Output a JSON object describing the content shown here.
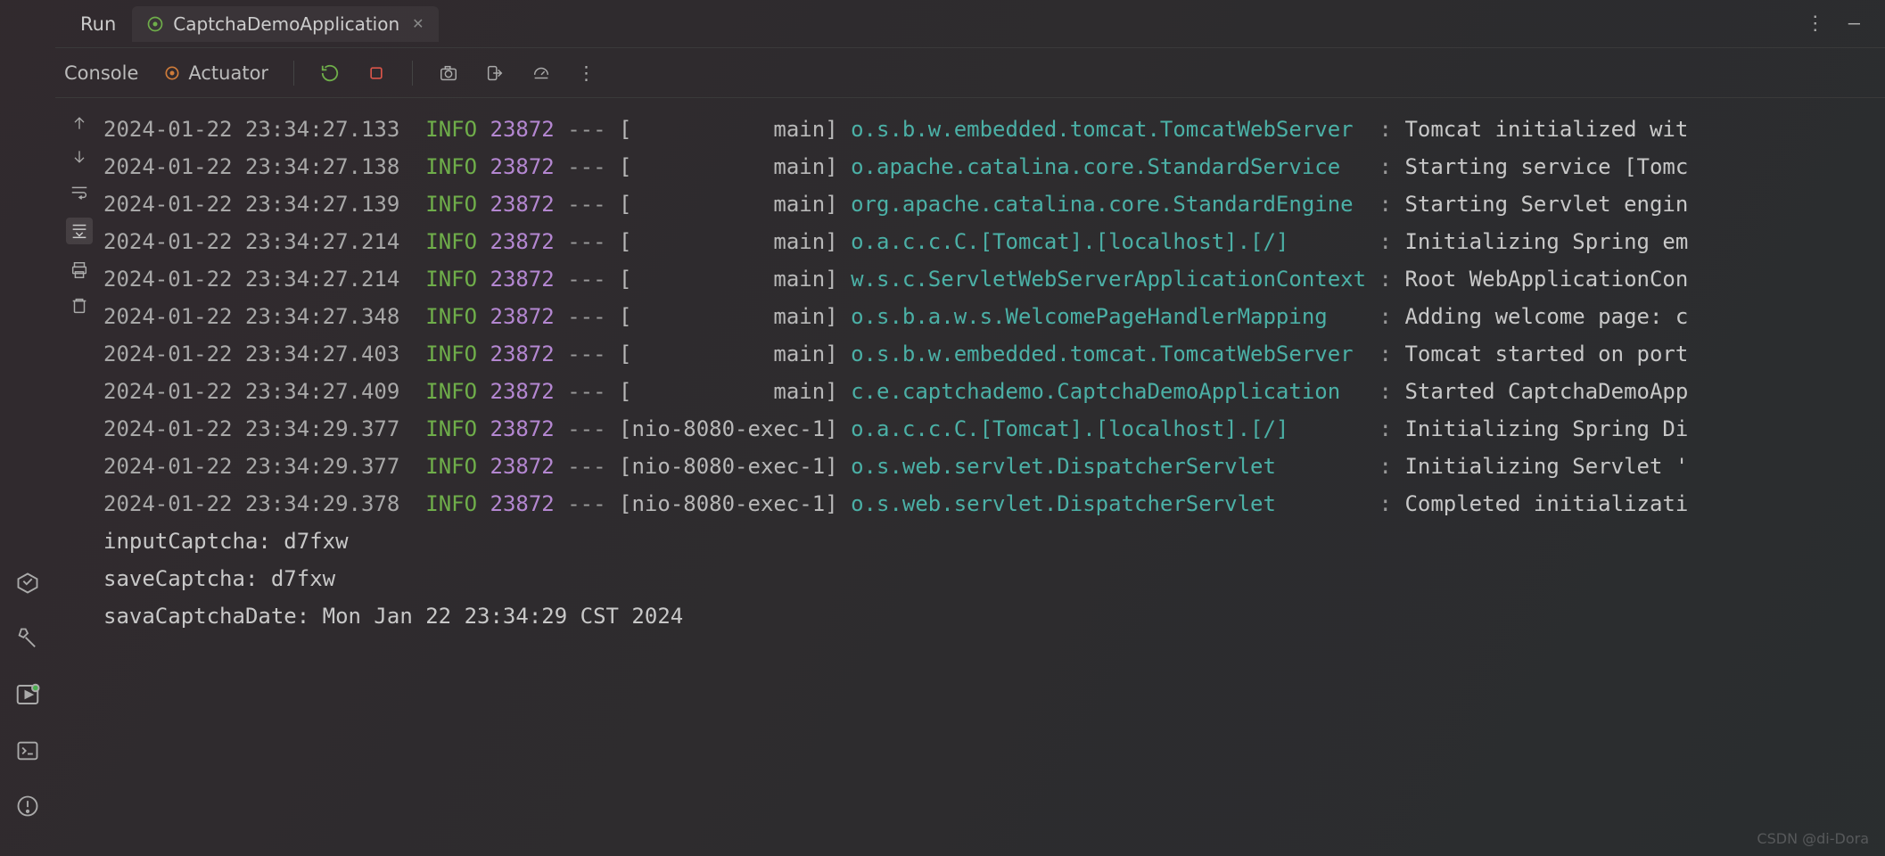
{
  "header": {
    "run_label": "Run",
    "app_tab": "CaptchaDemoApplication"
  },
  "toolbar": {
    "console_label": "Console",
    "actuator_label": "Actuator"
  },
  "log": {
    "lines": [
      {
        "ts": "2024-01-22 23:34:27.133",
        "level": "INFO",
        "pid": "23872",
        "thread": "[           main]",
        "logger": "o.s.b.w.embedded.tomcat.TomcatWebServer",
        "msg": "Tomcat initialized wit"
      },
      {
        "ts": "2024-01-22 23:34:27.138",
        "level": "INFO",
        "pid": "23872",
        "thread": "[           main]",
        "logger": "o.apache.catalina.core.StandardService",
        "msg": "Starting service [Tomc"
      },
      {
        "ts": "2024-01-22 23:34:27.139",
        "level": "INFO",
        "pid": "23872",
        "thread": "[           main]",
        "logger": "org.apache.catalina.core.StandardEngine",
        "msg": "Starting Servlet engin"
      },
      {
        "ts": "2024-01-22 23:34:27.214",
        "level": "INFO",
        "pid": "23872",
        "thread": "[           main]",
        "logger": "o.a.c.c.C.[Tomcat].[localhost].[/]",
        "msg": "Initializing Spring em"
      },
      {
        "ts": "2024-01-22 23:34:27.214",
        "level": "INFO",
        "pid": "23872",
        "thread": "[           main]",
        "logger": "w.s.c.ServletWebServerApplicationContext",
        "msg": "Root WebApplicationCon"
      },
      {
        "ts": "2024-01-22 23:34:27.348",
        "level": "INFO",
        "pid": "23872",
        "thread": "[           main]",
        "logger": "o.s.b.a.w.s.WelcomePageHandlerMapping",
        "msg": "Adding welcome page: c"
      },
      {
        "ts": "2024-01-22 23:34:27.403",
        "level": "INFO",
        "pid": "23872",
        "thread": "[           main]",
        "logger": "o.s.b.w.embedded.tomcat.TomcatWebServer",
        "msg": "Tomcat started on port"
      },
      {
        "ts": "2024-01-22 23:34:27.409",
        "level": "INFO",
        "pid": "23872",
        "thread": "[           main]",
        "logger": "c.e.captchademo.CaptchaDemoApplication",
        "msg": "Started CaptchaDemoApp"
      },
      {
        "ts": "2024-01-22 23:34:29.377",
        "level": "INFO",
        "pid": "23872",
        "thread": "[nio-8080-exec-1]",
        "logger": "o.a.c.c.C.[Tomcat].[localhost].[/]",
        "msg": "Initializing Spring Di"
      },
      {
        "ts": "2024-01-22 23:34:29.377",
        "level": "INFO",
        "pid": "23872",
        "thread": "[nio-8080-exec-1]",
        "logger": "o.s.web.servlet.DispatcherServlet",
        "msg": "Initializing Servlet '"
      },
      {
        "ts": "2024-01-22 23:34:29.378",
        "level": "INFO",
        "pid": "23872",
        "thread": "[nio-8080-exec-1]",
        "logger": "o.s.web.servlet.DispatcherServlet",
        "msg": "Completed initializati"
      }
    ],
    "plain_lines": [
      "inputCaptcha: d7fxw",
      "saveCaptcha: d7fxw",
      "savaCaptchaDate: Mon Jan 22 23:34:29 CST 2024"
    ]
  },
  "watermark": "CSDN @di-Dora"
}
